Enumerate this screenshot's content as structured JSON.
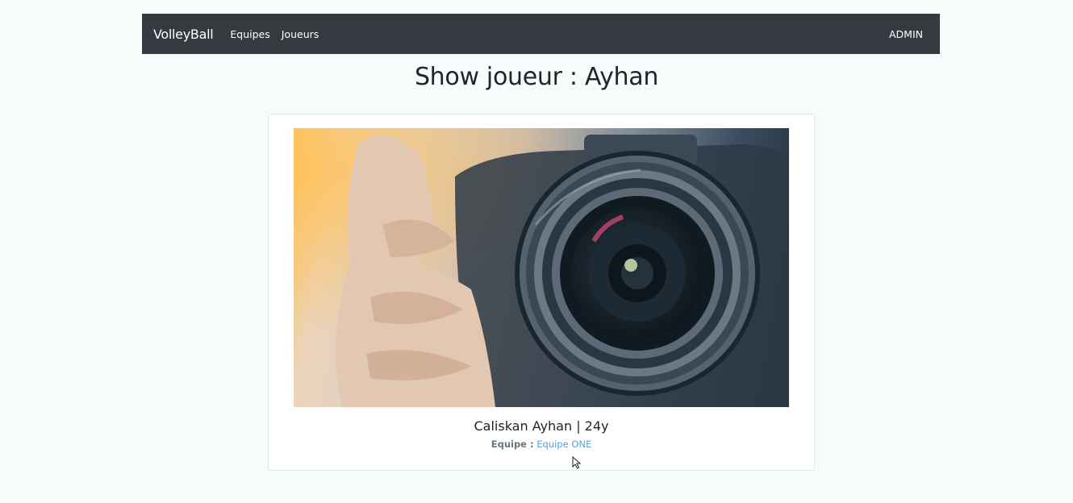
{
  "navbar": {
    "brand": "VolleyBall",
    "links": [
      {
        "label": "Equipes"
      },
      {
        "label": "Joueurs"
      }
    ],
    "admin_label": "ADMIN"
  },
  "page": {
    "title": "Show joueur : Ayhan"
  },
  "player_card": {
    "image_icon": "camera-lens-photo",
    "name_age": "Caliskan Ayhan | 24y",
    "team_label": "Equipe :",
    "team_link": "Equipe ONE"
  },
  "colors": {
    "navbar_bg": "#343a40",
    "page_bg": "#f6fcfc",
    "link": "#5a9fd4"
  }
}
